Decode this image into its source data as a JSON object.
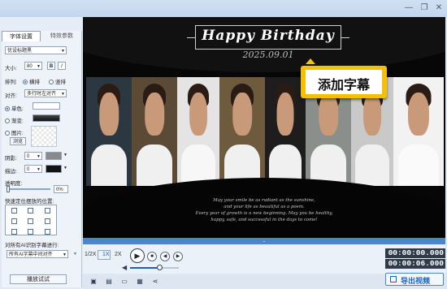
{
  "window": {
    "minimize": "—",
    "restore": "❐",
    "close": "✕"
  },
  "tabs": [
    {
      "label": "字体设置"
    },
    {
      "label": "特效参数"
    }
  ],
  "left": {
    "font": {
      "value": "优设标题黑"
    },
    "size_label": "大小:",
    "size_value": "80",
    "bold": "B",
    "italic": "I",
    "arrange_label": "排列:",
    "arrange_options": [
      "横排",
      "竖排"
    ],
    "align_label": "对齐:",
    "align_value": "多行时左对齐",
    "fill": {
      "single": "单色:",
      "gradient": "渐变:",
      "image": "图片:",
      "browse": "浏览"
    },
    "shadow_label": "阴影:",
    "shadow_value": "0",
    "stroke_label": "描边:",
    "stroke_value": "0",
    "opacity_label": "透明度:",
    "opacity_value": "0%",
    "position_label": "快速定位摆放的位置:",
    "ai_label": "对所有AI识别字幕进行:",
    "ai_value": "所有AI字幕中间对齐",
    "preview_button": "播放试试"
  },
  "canvas": {
    "title": "Happy Birthday",
    "date": "2025.09.01",
    "callout": "添加字幕",
    "body_lines": [
      "May your smile be as radiant as the sunshine,",
      "and your life as beautiful as a poem.",
      "Every year of growth is a new beginning. May you be healthy,",
      "happy, safe, and successful in the days to come!"
    ]
  },
  "playback": {
    "speeds": [
      "1/2X",
      "1X",
      "2X"
    ],
    "active_speed": "1X",
    "time_current": "00:00:00.000",
    "time_total": "00:00:06.000",
    "volume_level": 0.6
  },
  "export_button": "导出视频",
  "colors": {
    "accent": "#1b5fbf",
    "timeline": "#4d86c8",
    "callout": "#f5c000",
    "titlebar": "#c6d9ef"
  },
  "icons": [
    "minimize-icon",
    "restore-icon",
    "close-icon",
    "bold-icon",
    "italic-icon",
    "play-icon",
    "stop-icon",
    "prev-icon",
    "next-icon",
    "volume-icon",
    "save-icon",
    "folder-icon",
    "open-icon",
    "disk-icon",
    "share-icon",
    "export-icon"
  ]
}
